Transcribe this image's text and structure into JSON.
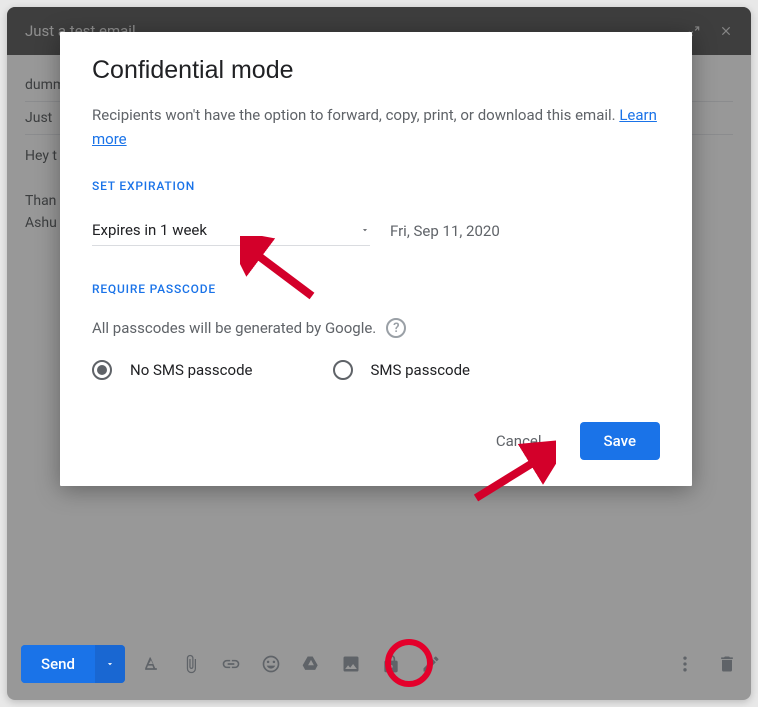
{
  "titlebar": {
    "title": "Just a test email"
  },
  "bg": {
    "to": "dumm",
    "subject": "Just",
    "body1": "Hey t",
    "body2a": "Than",
    "body2b": "Ashu"
  },
  "dialog": {
    "title": "Confidential mode",
    "desc1": "Recipients won't have the option to forward, copy, print, or download this email. ",
    "learn": "Learn more",
    "expiration_label": "SET EXPIRATION",
    "expiry_value": "Expires in 1 week",
    "expiry_date": "Fri, Sep 11, 2020",
    "passcode_label": "REQUIRE PASSCODE",
    "passcode_desc": "All passcodes will be generated by Google.",
    "radio_no_sms": "No SMS passcode",
    "radio_sms": "SMS passcode",
    "cancel": "Cancel",
    "save": "Save"
  },
  "bottombar": {
    "send": "Send"
  }
}
